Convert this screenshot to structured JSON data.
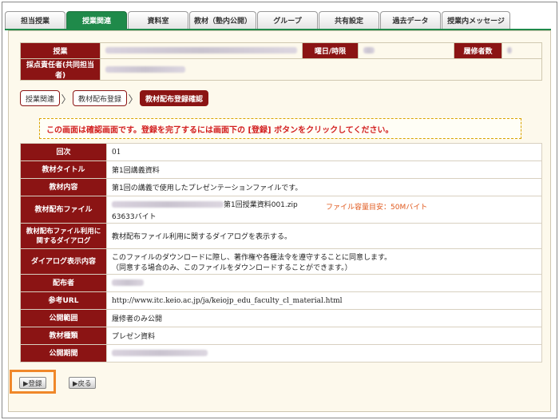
{
  "tabs": [
    "担当授業",
    "授業関連",
    "資料室",
    "教材（塾内公開）",
    "グループ",
    "共有設定",
    "過去データ",
    "授業内メッセージ"
  ],
  "header": {
    "class_label": "授業",
    "day_label": "曜日/時限",
    "students_label": "履修者数",
    "grader_label": "採点責任者(共同担当者)"
  },
  "breadcrumb": {
    "item1": "授業関連",
    "item2": "教材配布登録",
    "current": "教材配布登録確認"
  },
  "notice": "この画面は確認画面です。登録を完了するには画面下の [登録] ボタンをクリックしてください。",
  "rows": {
    "kaiji": {
      "label": "回次",
      "value": "01"
    },
    "title": {
      "label": "教材タイトル",
      "value": "第1回講義資料"
    },
    "content": {
      "label": "教材内容",
      "value": "第1回の講義で使用したプレゼンテーションファイルです。"
    },
    "file": {
      "label": "教材配布ファイル",
      "filename": "第1回授業資料001.zip",
      "size": "63633バイト",
      "capacity": "ファイル容量目安：50Mバイト"
    },
    "dialog": {
      "label1": "教材配布ファイル利用に",
      "label2": "関するダイアログ",
      "value": "教材配布ファイル利用に関するダイアログを表示する。"
    },
    "dialog_content": {
      "label": "ダイアログ表示内容",
      "line1": "このファイルのダウンロードに際し、著作権や各種法令を遵守することに同意します。",
      "line2": "（同意する場合のみ、このファイルをダウンロードすることができます。）"
    },
    "distributor": {
      "label": "配布者"
    },
    "ref_url": {
      "label": "参考URL",
      "value": "http://www.itc.keio.ac.jp/ja/keiojp_edu_faculty_cl_material.html"
    },
    "scope": {
      "label": "公開範囲",
      "value": "履修者のみ公開"
    },
    "type": {
      "label": "教材種類",
      "value": "プレゼン資料"
    },
    "period": {
      "label": "公開期間"
    }
  },
  "buttons": {
    "register": "▶登録",
    "back": "▶戻る"
  }
}
